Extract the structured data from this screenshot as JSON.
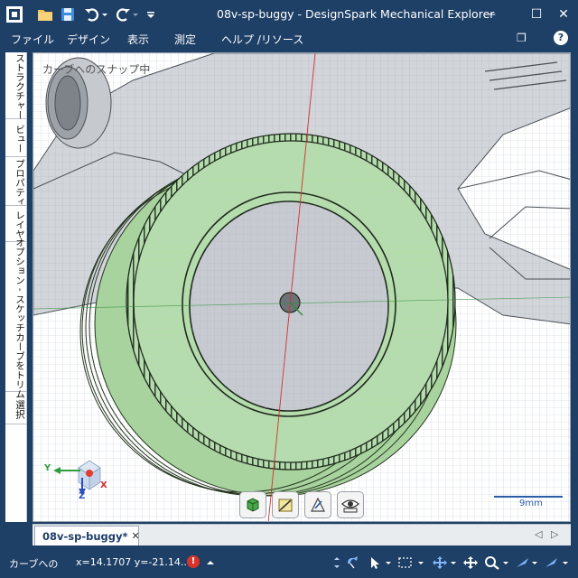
{
  "app": {
    "title": "08v-sp-buggy - DesignSpark Mechanical Explorer",
    "accent_color": "#1e3f66"
  },
  "quick_access": {
    "icons": [
      "app-logo-icon",
      "open-folder-icon",
      "save-icon",
      "undo-icon",
      "undo-dropdown-icon",
      "redo-icon",
      "redo-dropdown-icon",
      "customize-icon"
    ]
  },
  "window_controls": {
    "minimize": "—",
    "maximize": "☐",
    "close": "✕",
    "restore": "❐"
  },
  "menu": {
    "items": [
      "ファイル",
      "デザイン",
      "表示",
      "測定",
      "ヘルプ /リソース"
    ],
    "help": "?"
  },
  "side_tabs": [
    "ストラクチャー",
    "ビュー",
    "プロパティ",
    "レイヤ",
    "オプション - スケッチカーブをトリム",
    "選択"
  ],
  "viewport": {
    "status_label": "カーブへのスナップ中",
    "axes": {
      "x": "X",
      "y": "Y",
      "z": "Z"
    },
    "scale_label": "9mm",
    "model_color": "#b5dcad",
    "tools": [
      "solid-view-icon",
      "sketch-plane-icon",
      "sketch-mode-icon",
      "visibility-icon"
    ]
  },
  "document_tab": {
    "name": "08v-sp-buggy*",
    "close": "✕",
    "nav_prev": "◁",
    "nav_next": "▷"
  },
  "statusbar": {
    "text": "カーブへの",
    "coords": "x=14.1707  y=-21.14...",
    "warning": "!",
    "tools": [
      "spin-icon",
      "pan-hand-icon",
      "select-icon",
      "box-select-icon",
      "move-icon",
      "pan-icon",
      "zoom-icon",
      "fly-icon",
      "orient-icon"
    ]
  }
}
